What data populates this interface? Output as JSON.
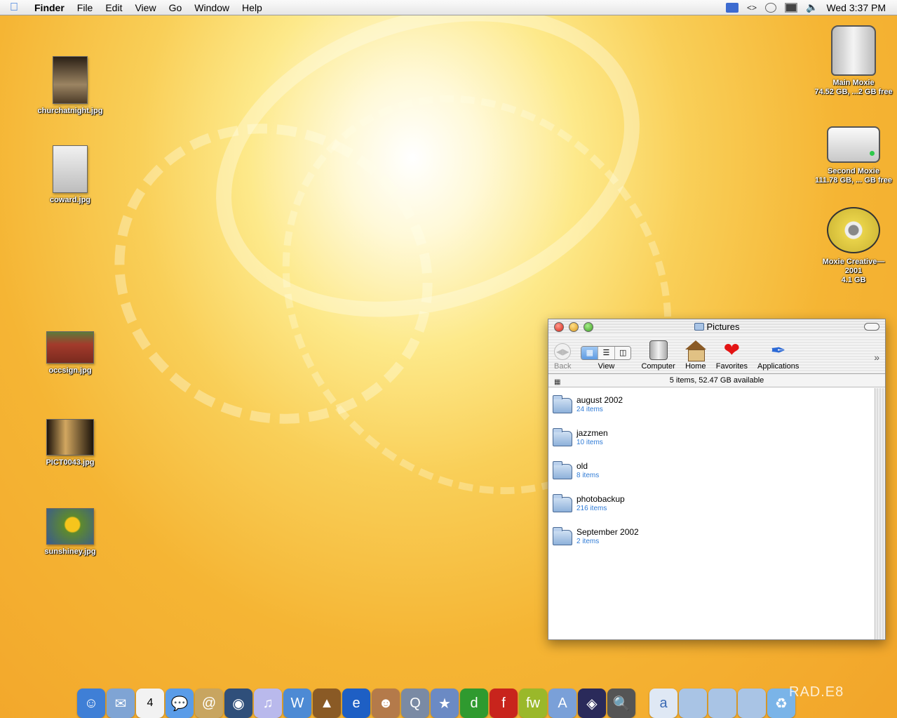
{
  "menubar": {
    "items": [
      "Finder",
      "File",
      "Edit",
      "View",
      "Go",
      "Window",
      "Help"
    ],
    "clock": "Wed 3:37 PM",
    "icons": [
      "apple-icon",
      "script-menu-icon",
      "arrows-icon",
      "chat-bubble-icon",
      "display-icon",
      "volume-icon"
    ]
  },
  "desktop": {
    "files": [
      {
        "name": "churchatnight.jpg",
        "color": "#6a5a46"
      },
      {
        "name": "coward.jpg",
        "color": "#d7d7d7"
      },
      {
        "name": "occsign.jpg",
        "color": "#a33b2c"
      },
      {
        "name": "PICT0043.jpg",
        "color": "#2a1d12"
      },
      {
        "name": "sunshiney.jpg",
        "color": "#5e8a2e"
      }
    ],
    "volumes": [
      {
        "line1": "Main Moxie",
        "line2": "74.52 GB, ...2 GB free",
        "line3": ""
      },
      {
        "line1": "Second Moxie",
        "line2": "111.78 GB, ... GB free",
        "line3": ""
      },
      {
        "line1": "Moxie Creative—",
        "line2": "2001",
        "line3": "4.1 GB"
      }
    ]
  },
  "window": {
    "title": "Pictures",
    "toolbar": {
      "back": "Back",
      "view": "View",
      "computer": "Computer",
      "home": "Home",
      "favorites": "Favorites",
      "applications": "Applications"
    },
    "status": "5 items, 52.47 GB available",
    "folders": [
      {
        "name": "august 2002",
        "count": "24 items"
      },
      {
        "name": "jazzmen",
        "count": "10 items"
      },
      {
        "name": "old",
        "count": "8 items"
      },
      {
        "name": "photobackup",
        "count": "216 items"
      },
      {
        "name": "September 2002",
        "count": "2 items"
      }
    ]
  },
  "dock": {
    "items": [
      "finder-icon",
      "mail-icon",
      "ical-icon",
      "ichat-icon",
      "address-book-icon",
      "sherlock-icon",
      "itunes-icon",
      "word-icon",
      "iphoto-icon",
      "internet-explorer-icon",
      "painter-icon",
      "quicktime-icon",
      "imovie-icon",
      "dreamweaver-icon",
      "flash-icon",
      "fireworks-icon",
      "terminal-icon",
      "eye-icon",
      "search-icon",
      "textedit-icon",
      "folder-icon",
      "folder-icon",
      "folder-icon",
      "trash-icon"
    ],
    "calendar_date": "4",
    "watermark": "RAD.E8"
  },
  "colors": {
    "accent_blue": "#2f7bd6",
    "close_red": "#d42415",
    "minimize_yellow": "#d9981a",
    "zoom_green": "#3c9d24"
  }
}
